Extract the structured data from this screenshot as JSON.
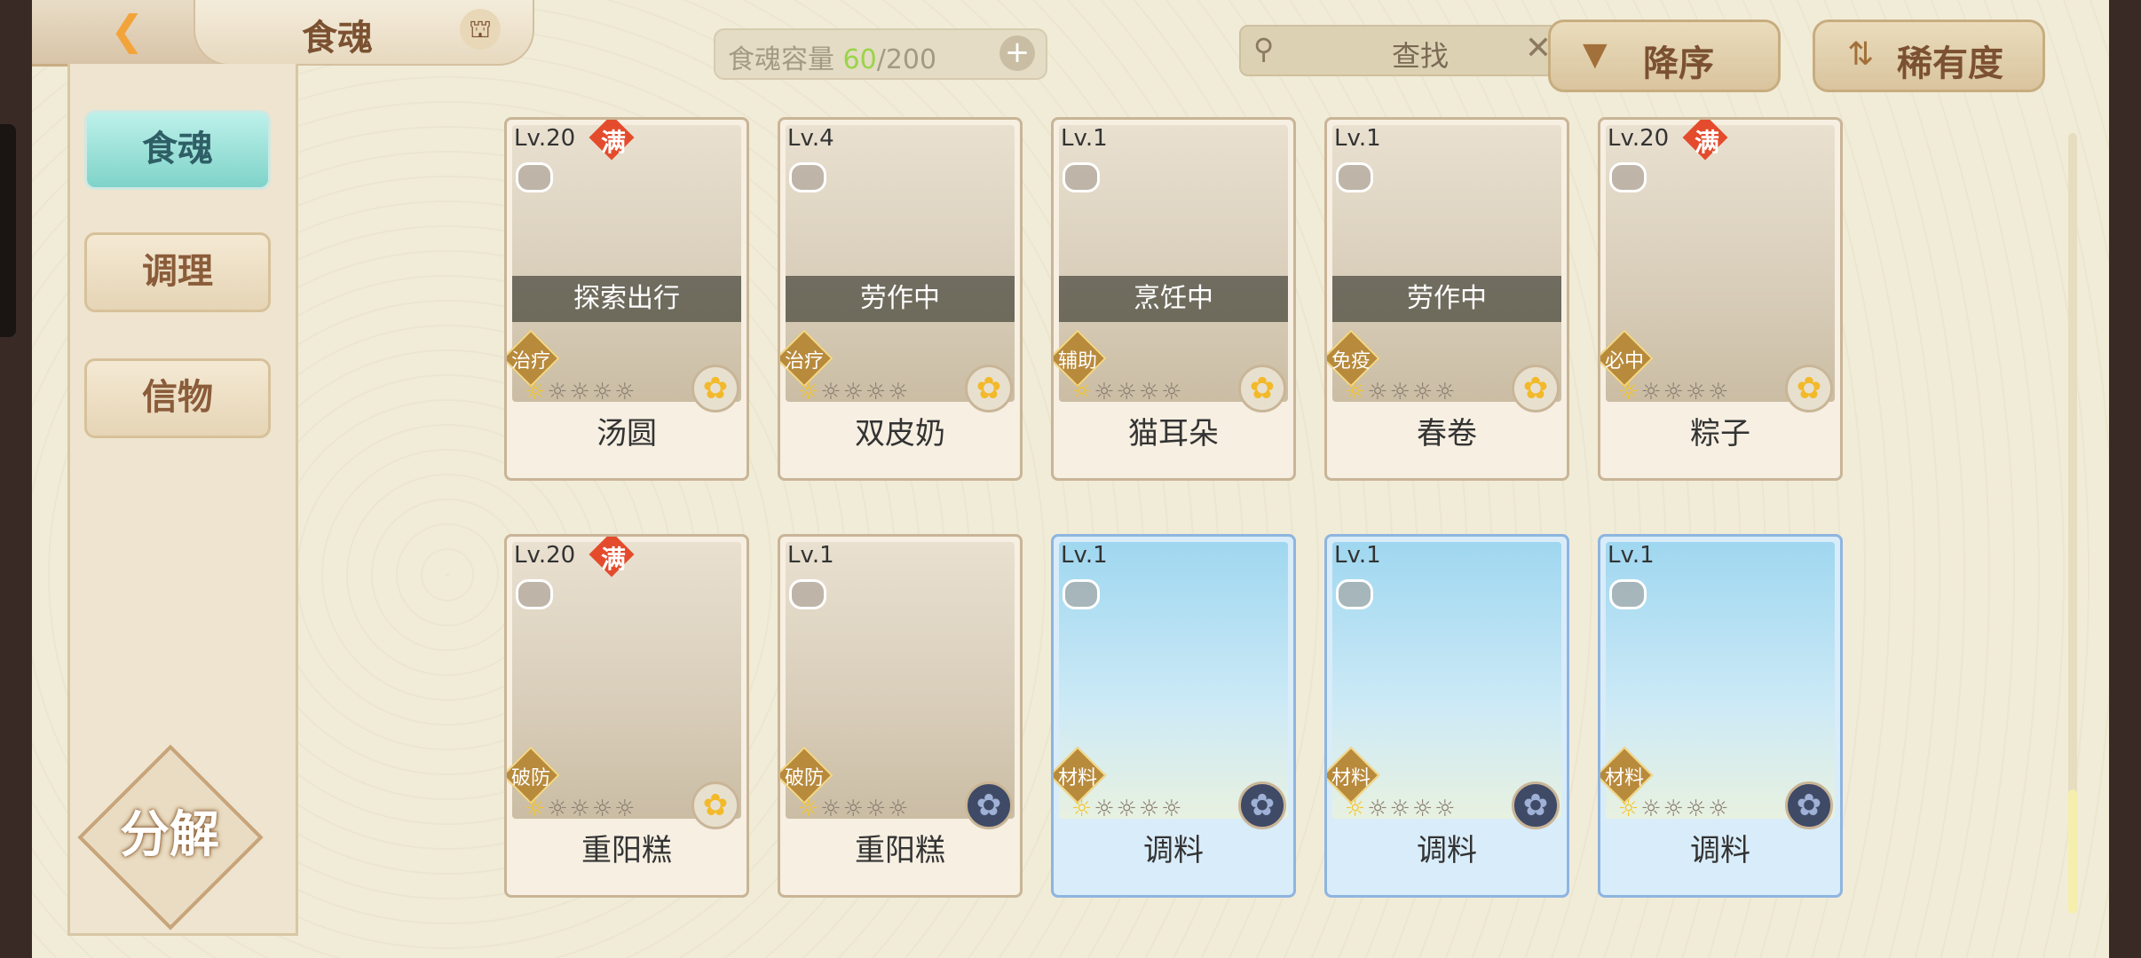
{
  "header": {
    "title": "食魂",
    "capacity": {
      "label": "食魂容量",
      "current": "60",
      "total": "/200"
    },
    "search_placeholder": "查找",
    "sort_order_label": "降序",
    "sort_key_label": "稀有度"
  },
  "sidebar": {
    "tabs": [
      {
        "label": "食魂",
        "active": true
      },
      {
        "label": "调理",
        "active": false
      },
      {
        "label": "信物",
        "active": false
      }
    ],
    "decompose_label": "分解"
  },
  "cards": [
    {
      "lv": "Lv.20",
      "max": "满",
      "status": "探索出行",
      "role": "治疗",
      "stars": 1,
      "name": "汤圆",
      "flower": "gold",
      "blue": false
    },
    {
      "lv": "Lv.4",
      "max": "",
      "status": "劳作中",
      "role": "治疗",
      "stars": 1,
      "name": "双皮奶",
      "flower": "gold",
      "blue": false
    },
    {
      "lv": "Lv.1",
      "max": "",
      "status": "烹饪中",
      "role": "辅助",
      "stars": 1,
      "name": "猫耳朵",
      "flower": "gold",
      "blue": false
    },
    {
      "lv": "Lv.1",
      "max": "",
      "status": "劳作中",
      "role": "免疫",
      "stars": 1,
      "name": "春卷",
      "flower": "gold",
      "blue": false
    },
    {
      "lv": "Lv.20",
      "max": "满",
      "status": "",
      "role": "必中",
      "stars": 1,
      "name": "粽子",
      "flower": "gold",
      "blue": false
    },
    {
      "lv": "Lv.20",
      "max": "满",
      "status": "",
      "role": "破防",
      "stars": 1,
      "name": "重阳糕",
      "flower": "gold",
      "blue": false
    },
    {
      "lv": "Lv.1",
      "max": "",
      "status": "",
      "role": "破防",
      "stars": 1,
      "name": "重阳糕",
      "flower": "dark",
      "blue": false
    },
    {
      "lv": "Lv.1",
      "max": "",
      "status": "",
      "role": "材料",
      "stars": 1,
      "name": "调料",
      "flower": "dark",
      "blue": true
    },
    {
      "lv": "Lv.1",
      "max": "",
      "status": "",
      "role": "材料",
      "stars": 1,
      "name": "调料",
      "flower": "dark",
      "blue": true
    },
    {
      "lv": "Lv.1",
      "max": "",
      "status": "",
      "role": "材料",
      "stars": 1,
      "name": "调料",
      "flower": "dark",
      "blue": true
    }
  ],
  "colors": {
    "accent": "#f2a43a",
    "capacity_current": "#9ad44a",
    "active_tab": "#7fd3c9"
  }
}
